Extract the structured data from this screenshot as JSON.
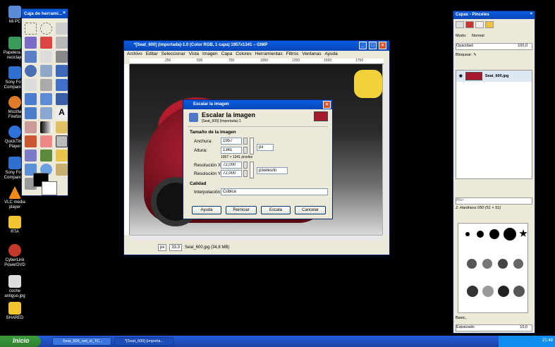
{
  "desktop": {
    "icons": [
      {
        "label": "Mi PC",
        "icon": "computer-icon"
      },
      {
        "label": "Papelera de reciclaje",
        "icon": "recycle-bin-icon"
      },
      {
        "label": "Sony Foto Companion",
        "icon": "sony-icon"
      },
      {
        "label": "Mozilla Firefox",
        "icon": "firefox-icon"
      },
      {
        "label": "QuickTime Player",
        "icon": "quicktime-icon"
      },
      {
        "label": "Sony Foto Companion",
        "icon": "sony-icon"
      },
      {
        "label": "VLC media player",
        "icon": "vlc-icon"
      },
      {
        "label": "RTA",
        "icon": "folder-icon"
      },
      {
        "label": "CyberLink PowerDVD",
        "icon": "powerdvd-icon"
      },
      {
        "label": "coche antiguo.jpg",
        "icon": "image-file-icon"
      },
      {
        "label": "SHARED",
        "icon": "shared-folder-icon"
      }
    ]
  },
  "toolbox": {
    "title": "Caja de herrami...",
    "close": "×"
  },
  "image_window": {
    "title": "*[Seat_600] (importada)-1.0 (Color RGB, 1 capa) 1957x1341 – GIMP",
    "menu": [
      "Archivo",
      "Editar",
      "Seleccionar",
      "Vista",
      "Imagen",
      "Capa",
      "Colores",
      "Herramientas",
      "Filtros",
      "Ventanas",
      "Ayuda"
    ],
    "ruler_marks": [
      "250",
      "500",
      "750",
      "1000",
      "1250",
      "1500",
      "1750"
    ],
    "status": {
      "unit": "px",
      "zoom": "33,3",
      "info": "Seat_600.jpg (34,8 MB)"
    }
  },
  "scale_dialog": {
    "title": "Escalar la imagen",
    "heading": "Escalar la imagen",
    "subheading": "[Seat_600] (importada)-1",
    "size_section": "Tamaño de la imagen",
    "width_label": "Anchura:",
    "width_value": "1957",
    "height_label": "Altura:",
    "height_value": "1341",
    "pixels_note": "1957 × 1341 píxeles",
    "unit_px": "px",
    "res_x_label": "Resolución X:",
    "res_x_value": "72,000",
    "res_y_label": "Resolución Y:",
    "res_y_value": "72,000",
    "res_unit": "píxeles/in",
    "quality_section": "Calidad",
    "interp_label": "Interpolación:",
    "interp_value": "Cúbica",
    "buttons": {
      "help": "Ayuda",
      "reset": "Reiniciar",
      "scale": "Escala",
      "cancel": "Cancelar"
    }
  },
  "layers_panel": {
    "title": "Capas - Pinceles",
    "mode_label": "Modo:",
    "mode_value": "Normal",
    "opacity_label": "Opacidad",
    "opacity_value": "100,0",
    "lock_label": "Bloquear:",
    "layer_name": "Seat_600.jpg",
    "brush_filter": "filter",
    "brush_name": "2. Hardness 050 (51 × 51)",
    "brush_mode": "Basic,",
    "spacing_label": "Espaciado",
    "spacing_value": "10,0"
  },
  "taskbar": {
    "start": "Inicio",
    "items": [
      "Seat_600_red_vl_TC...",
      "*[Seat_600] (importa..."
    ],
    "clock": "21:48"
  }
}
